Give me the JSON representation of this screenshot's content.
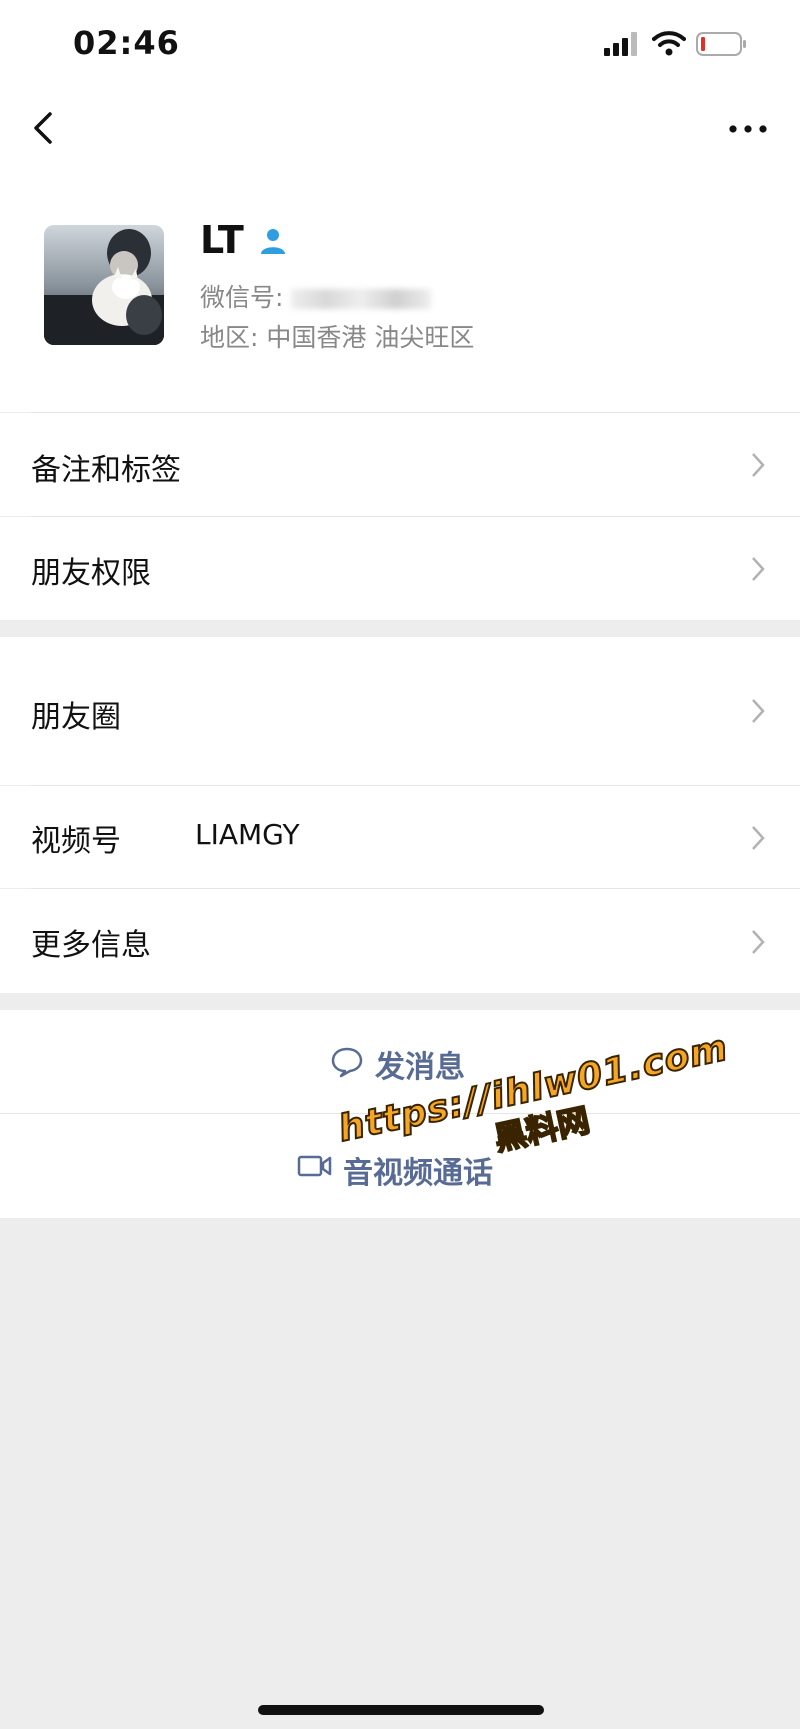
{
  "status_bar": {
    "time": "02:46"
  },
  "profile": {
    "name": "LT",
    "wechat_id_label": "微信号:",
    "wechat_id_value": "",
    "region": "地区: 中国香港 油尖旺区"
  },
  "menu": {
    "remarks_tags": "备注和标签",
    "friend_permissions": "朋友权限",
    "moments": "朋友圈",
    "channels": "视频号",
    "channels_value": "LIAMGY",
    "more_info": "更多信息"
  },
  "actions": {
    "send_message": "发消息",
    "av_call": "音视频通话"
  },
  "watermark": {
    "url": "https://ihlw01.com",
    "name": "黑料网"
  },
  "colors": {
    "link_blue": "#576b95",
    "verified_blue": "#2f9ee0",
    "watermark_orange": "#f5a623"
  }
}
